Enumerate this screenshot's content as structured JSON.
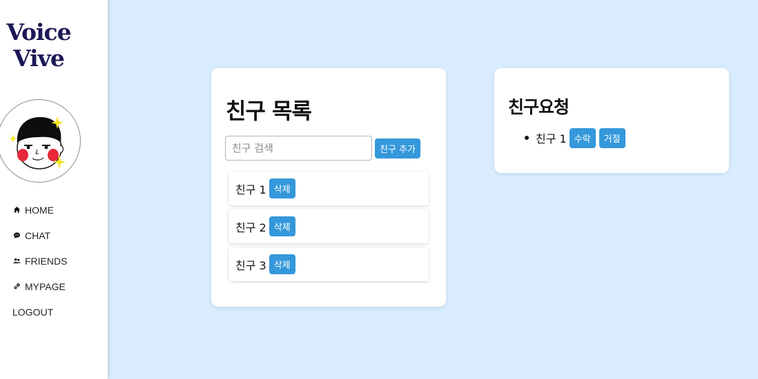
{
  "app": {
    "logo_line1": "Voice",
    "logo_line2": "Vive"
  },
  "sidebar": {
    "items": [
      {
        "label": "HOME",
        "icon": "home-icon"
      },
      {
        "label": "CHAT",
        "icon": "chat-bubble-icon"
      },
      {
        "label": "FRIENDS",
        "icon": "users-icon"
      },
      {
        "label": "MYPAGE",
        "icon": "user-gear-icon"
      },
      {
        "label": "LOGOUT",
        "icon": ""
      }
    ]
  },
  "friends_card": {
    "title": "친구 목록",
    "search_placeholder": "친구 검색",
    "add_button": "친구 추가",
    "friends": [
      {
        "name": "친구 1",
        "delete_label": "삭제"
      },
      {
        "name": "친구 2",
        "delete_label": "삭제"
      },
      {
        "name": "친구 3",
        "delete_label": "삭제"
      }
    ]
  },
  "requests_card": {
    "title": "친구요청",
    "requests": [
      {
        "name": "친구 1",
        "accept_label": "수락",
        "reject_label": "거절"
      }
    ]
  },
  "colors": {
    "background": "#d8ecfd",
    "accent": "#3498db",
    "logo": "#1d1856"
  }
}
